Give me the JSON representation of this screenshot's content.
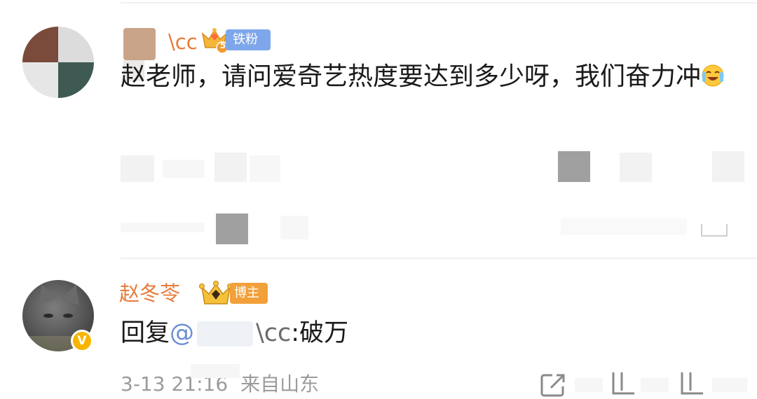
{
  "comment1": {
    "username_visible": "\\cc",
    "badge_label": "铁粉1",
    "badge_level": "5",
    "text": "赵老师，请问爱奇艺热度要达到多少呀，我们奋力冲"
  },
  "comment2": {
    "username": "赵冬苓",
    "badge_label": "博主",
    "verified_mark": "V",
    "reply_prefix": "回复",
    "reply_at": "@",
    "reply_target_tail": "\\cc",
    "reply_text": ":破万",
    "time": "3-13 21:16",
    "location": "来自山东"
  },
  "icons": [
    "share-icon",
    "comment-icon",
    "like-icon",
    "crown-icon",
    "verified-icon",
    "laugh-cry-emoji"
  ],
  "colors": {
    "username": "#e77c3b",
    "fan_badge": "#7ea6ea",
    "host_badge": "#f2a03a",
    "meta_text": "#9b9b9b",
    "verified": "#f7b500"
  }
}
